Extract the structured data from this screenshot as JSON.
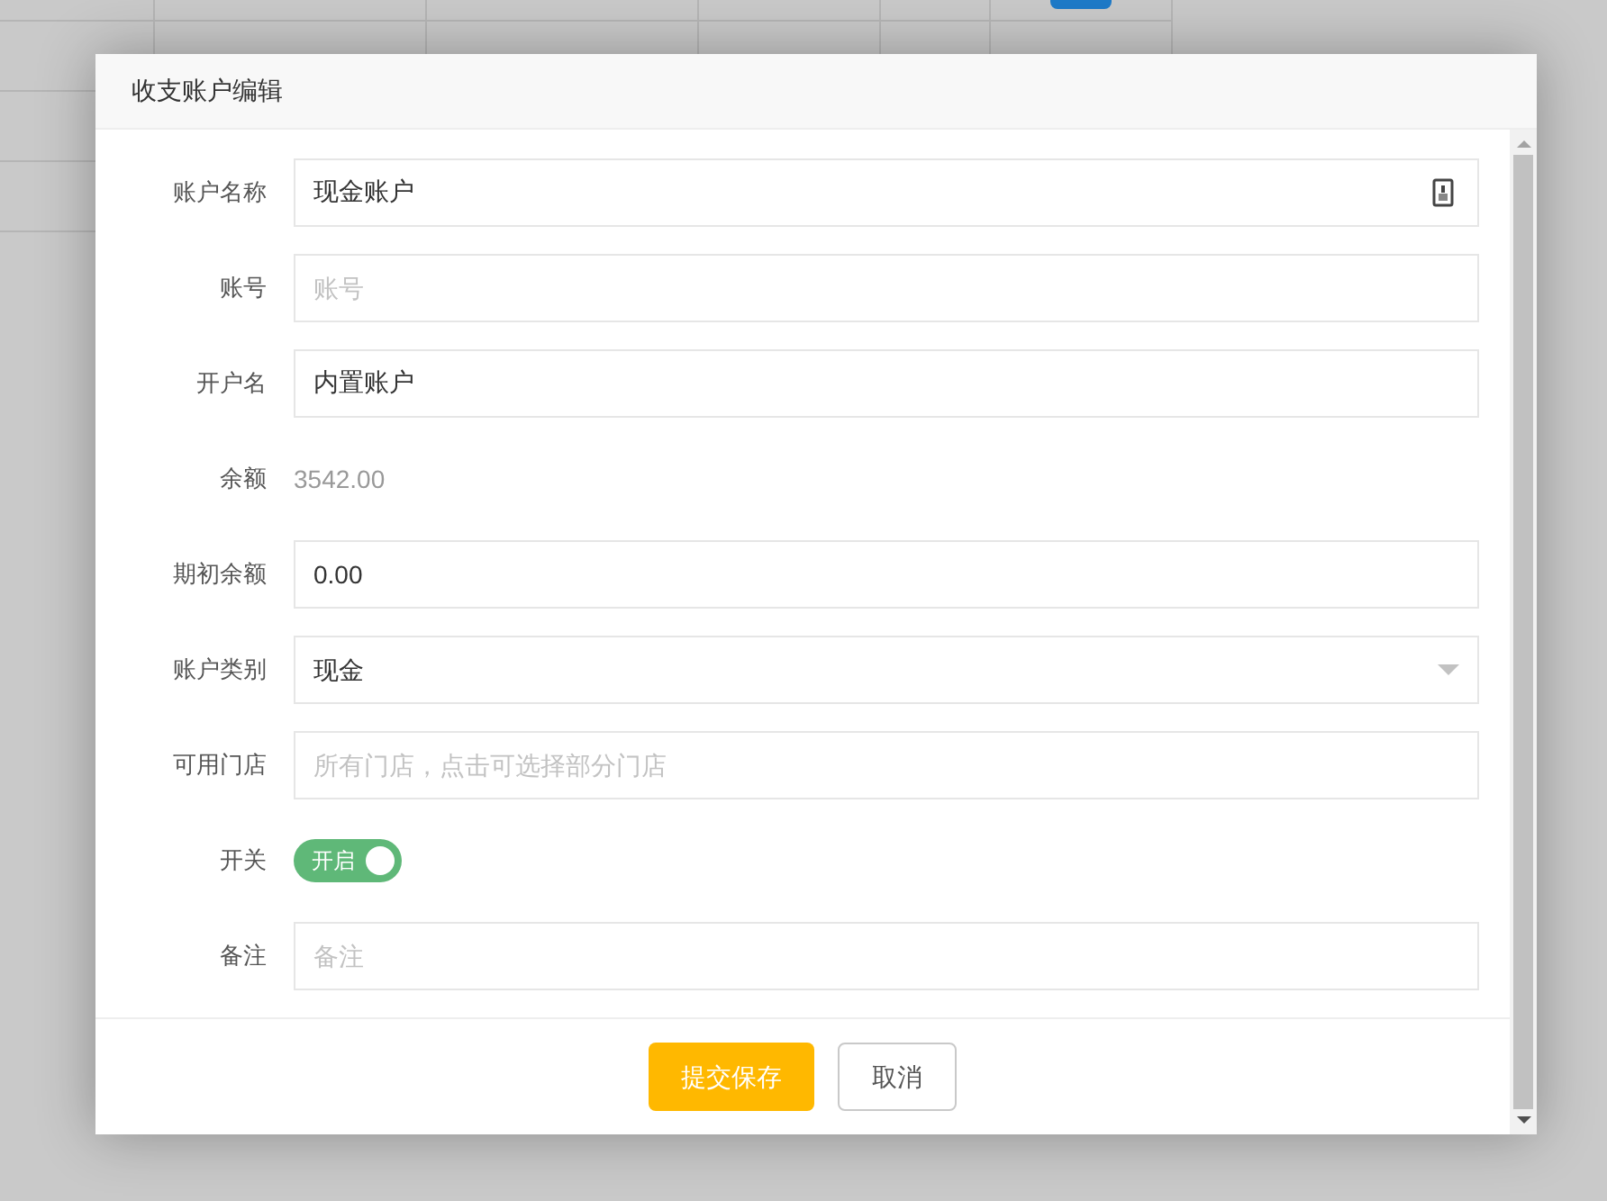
{
  "dialog": {
    "title": "收支账户编辑"
  },
  "fields": [
    {
      "kind": "input",
      "label": "账户名称",
      "value": "现金账户",
      "icon": true
    },
    {
      "kind": "input",
      "label": "账号",
      "placeholder": "账号"
    },
    {
      "kind": "input",
      "label": "开户名",
      "value": "内置账户"
    },
    {
      "kind": "static",
      "label": "余额",
      "value": "3542.00"
    },
    {
      "kind": "input",
      "label": "期初余额",
      "value": "0.00"
    },
    {
      "kind": "select",
      "label": "账户类别",
      "value": "现金"
    },
    {
      "kind": "input",
      "label": "可用门店",
      "placeholder": "所有门店，点击可选择部分门店"
    },
    {
      "kind": "toggle",
      "label": "开关",
      "on": true,
      "text": "开启"
    },
    {
      "kind": "input",
      "label": "备注",
      "placeholder": "备注"
    }
  ],
  "buttons": [
    {
      "kind": "primary",
      "label": "提交保存"
    },
    {
      "kind": "secondary",
      "label": "取消"
    }
  ]
}
